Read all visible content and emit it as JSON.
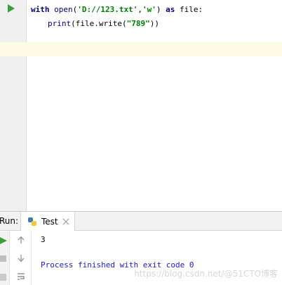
{
  "editor": {
    "line1": {
      "kw_with": "with",
      "fn_open": "open",
      "paren_open": "(",
      "str_path": "'D://123.txt'",
      "comma": ",",
      "str_mode": "'w'",
      "paren_close": ")",
      "kw_as": "as",
      "ident_file": "file:"
    },
    "line2": {
      "fn_print": "print",
      "rest_1": "(file.write(",
      "str_value": "\"789\"",
      "rest_2": "))"
    }
  },
  "run": {
    "label": "Run:",
    "tab_title": "Test"
  },
  "console": {
    "output_line": "3",
    "exit_line": "Process finished with exit code 0"
  },
  "watermark": {
    "text": "https://blog.csdn.net/@51CTO博客"
  },
  "colors": {
    "run_green": "#3c9f3c",
    "gutter_bg": "#f0f0f0",
    "current_line": "#fdfbe6",
    "keyword": "#000080",
    "string": "#008000",
    "exit_text": "#1a1ac8"
  },
  "icons": {
    "run_gutter": "play-icon",
    "python": "python-icon",
    "close": "close-icon",
    "rerun": "rerun-icon",
    "stop": "stop-icon",
    "pin": "pin-icon",
    "up": "arrow-up-icon",
    "down": "arrow-down-icon",
    "wrap": "soft-wrap-icon"
  }
}
